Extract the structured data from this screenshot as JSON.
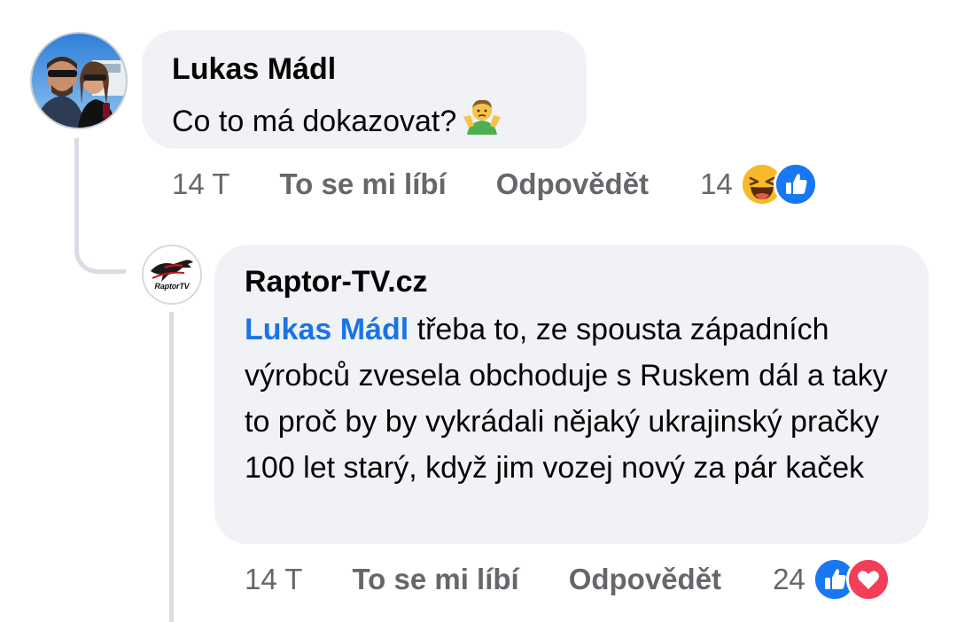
{
  "comments": [
    {
      "author": "Lukas Mádl",
      "text": "Co to má dokazovat?",
      "emoji_icon": "person-shrugging-icon",
      "actions": {
        "time": "14 T",
        "like": "To se mi líbí",
        "reply": "Odpovědět",
        "reaction_count": "14",
        "reactions": [
          "laugh-reaction-icon",
          "like-reaction-icon"
        ]
      }
    },
    {
      "author": "Raptor-TV.cz",
      "avatar_text": "RaptorTV",
      "mention": "Lukas Mádl",
      "text": " třeba to, ze spousta západních výrobců zvesela obchoduje s Ruskem dál a taky to proč by by vykrádali nějaký ukrajinský pračky 100 let starý, když jim vozej nový za pár kaček",
      "actions": {
        "time": "14 T",
        "like": "To se mi líbí",
        "reply": "Odpovědět",
        "reaction_count": "24",
        "reactions": [
          "like-reaction-icon",
          "love-reaction-icon"
        ]
      }
    }
  ],
  "colors": {
    "bubble": "#f0f2f5",
    "mention": "#1b74e4",
    "secondary_text": "#65676b",
    "like_blue": "#1877f2",
    "love_red": "#f33e58",
    "haha_yellow": "#f7b928"
  }
}
